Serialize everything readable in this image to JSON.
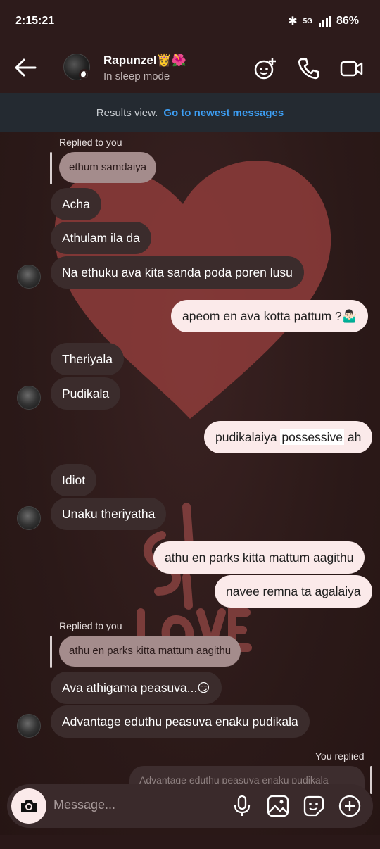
{
  "status_bar": {
    "time": "2:15:21",
    "network": "5G",
    "battery": "86%"
  },
  "header": {
    "name": "Rapunzel👸🌺",
    "subtitle": "In sleep mode"
  },
  "results_bar": {
    "text": "Results view.",
    "link": "Go to newest messages"
  },
  "messages": [
    {
      "replied_label": "Replied to you",
      "quote": "ethum samdaiya"
    },
    {
      "text": "Acha"
    },
    {
      "text": "Athulam ila da"
    },
    {
      "text": "Na ethuku ava kita sanda poda poren lusu"
    },
    {
      "text": "apeom en ava kotta pattum ?🤷🏻‍♂️"
    },
    {
      "text": "Theriyala"
    },
    {
      "text": "Pudikala"
    },
    {
      "text_before": "pudikalaiya ",
      "highlight": "possessive",
      "text_after": " ah"
    },
    {
      "text": "Idiot"
    },
    {
      "text": "Unaku theriyatha"
    },
    {
      "text": "athu en parks kitta mattum aagithu"
    },
    {
      "text": "navee remna ta agalaiya"
    },
    {
      "replied_label": "Replied to you",
      "quote": "athu en parks kitta mattum aagithu"
    },
    {
      "text": "Ava athigama peasuva...😏"
    },
    {
      "text": "Advantage eduthu peasuva enaku pudikala"
    },
    {
      "replied_label": "You replied",
      "quote": "Advantage eduthu peasuva enaku pudikala"
    }
  ],
  "composer": {
    "placeholder": "Message..."
  },
  "colors": {
    "incoming": "#3b2c2c",
    "outgoing": "#fbeaea",
    "link": "#3d9ff5"
  }
}
